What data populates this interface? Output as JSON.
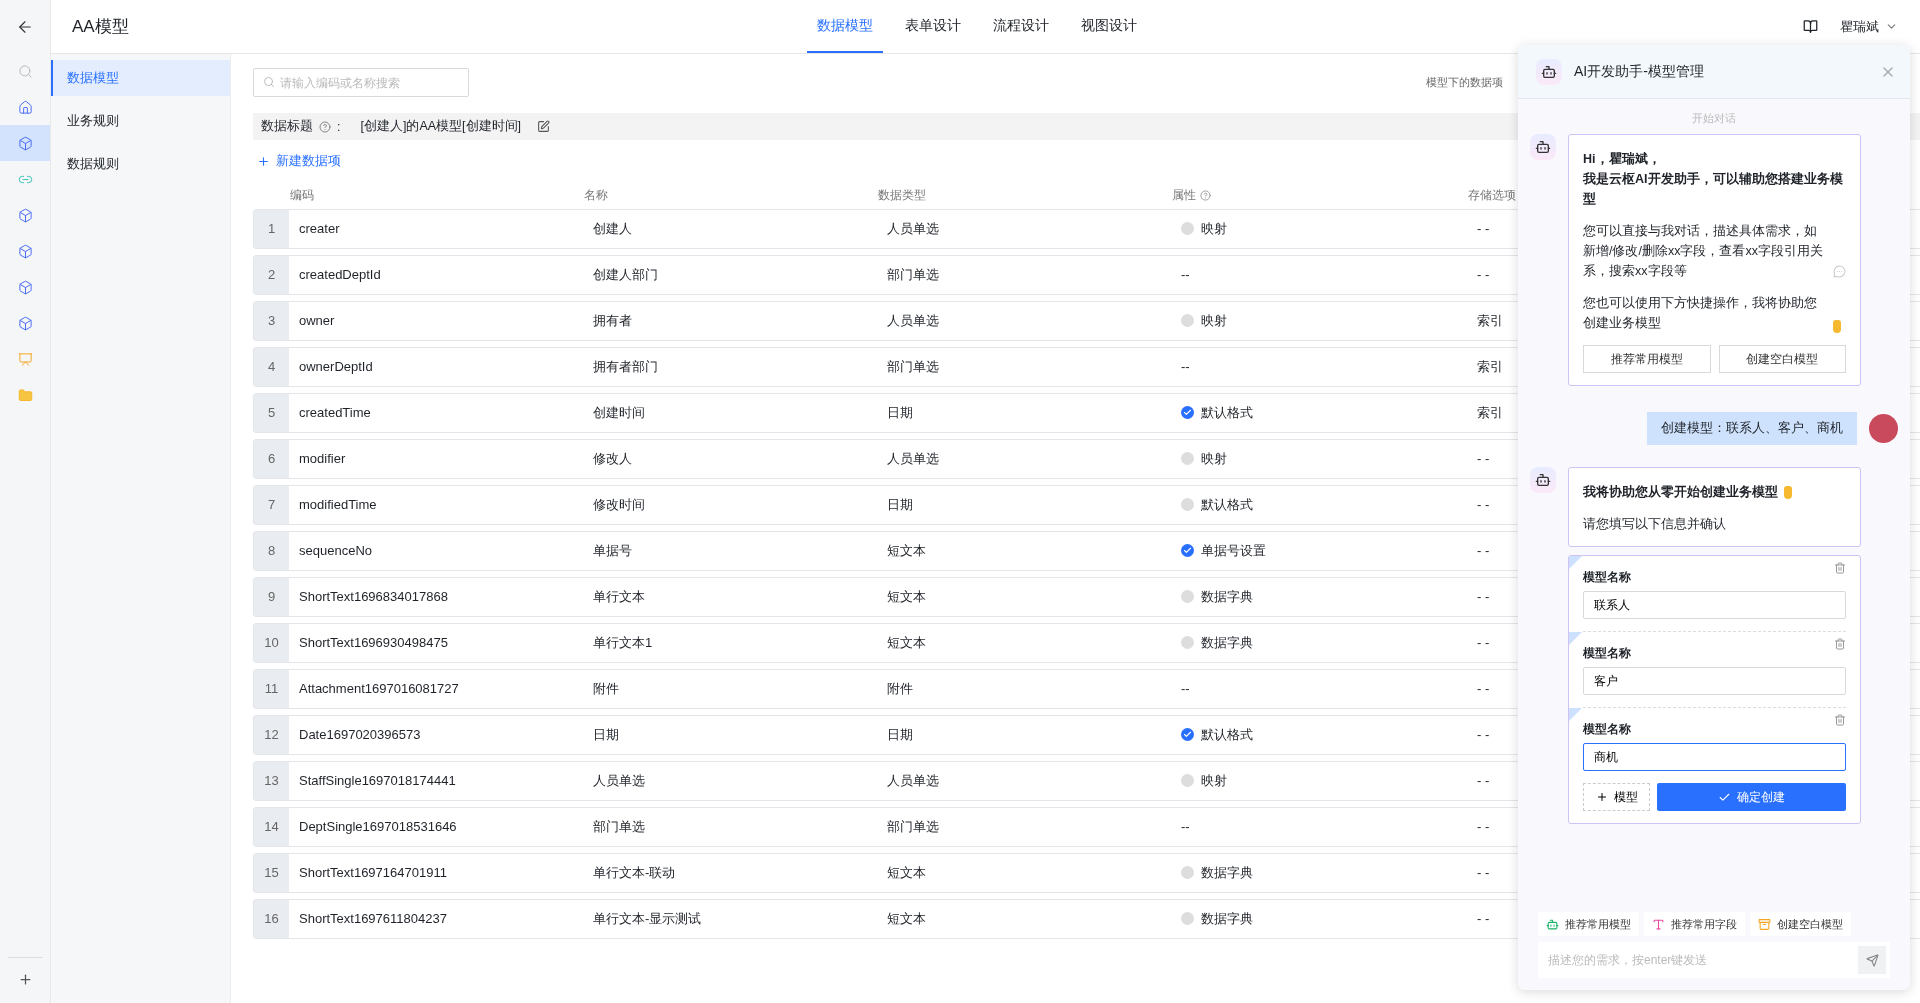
{
  "header": {
    "title": "AA模型",
    "tabs": [
      {
        "label": "数据模型",
        "selected": true
      },
      {
        "label": "表单设计",
        "selected": false
      },
      {
        "label": "流程设计",
        "selected": false
      },
      {
        "label": "视图设计",
        "selected": false
      }
    ],
    "user": "瞿瑞斌"
  },
  "rail": [
    {
      "kind": "search",
      "selected": false
    },
    {
      "kind": "home",
      "selected": false
    },
    {
      "kind": "cube",
      "selected": true
    },
    {
      "kind": "link",
      "selected": false
    },
    {
      "kind": "cube",
      "selected": false
    },
    {
      "kind": "cube",
      "selected": false
    },
    {
      "kind": "cube",
      "selected": false
    },
    {
      "kind": "cube",
      "selected": false
    },
    {
      "kind": "chart",
      "selected": false
    },
    {
      "kind": "folder",
      "selected": false
    }
  ],
  "sidebar": {
    "items": [
      {
        "label": "数据模型",
        "selected": true
      },
      {
        "label": "业务规则",
        "selected": false
      },
      {
        "label": "数据规则",
        "selected": false
      }
    ]
  },
  "toolbar": {
    "search_placeholder": "请输入编码或名称搜索",
    "note": "模型下的数据项"
  },
  "data_title": {
    "label": "数据标题",
    "separator": ":",
    "value": "[创建人]的AA模型[创建时间]"
  },
  "add_item": "新建数据项",
  "table": {
    "columns": [
      {
        "label": "编码",
        "help": false
      },
      {
        "label": "名称",
        "help": false
      },
      {
        "label": "数据类型",
        "help": false
      },
      {
        "label": "属性",
        "help": true
      },
      {
        "label": "存储选项",
        "help": false
      }
    ],
    "rows": [
      {
        "index": "1",
        "code": "creater",
        "name": "创建人",
        "type": "人员单选",
        "attribute": {
          "kind": "option",
          "label": "映射",
          "checked": false
        },
        "storage": "- -"
      },
      {
        "index": "2",
        "code": "createdDeptId",
        "name": "创建人部门",
        "type": "部门单选",
        "attribute": {
          "kind": "text",
          "label": "--"
        },
        "storage": "- -"
      },
      {
        "index": "3",
        "code": "owner",
        "name": "拥有者",
        "type": "人员单选",
        "attribute": {
          "kind": "option",
          "label": "映射",
          "checked": false
        },
        "storage": "索引"
      },
      {
        "index": "4",
        "code": "ownerDeptId",
        "name": "拥有者部门",
        "type": "部门单选",
        "attribute": {
          "kind": "text",
          "label": "--"
        },
        "storage": "索引"
      },
      {
        "index": "5",
        "code": "createdTime",
        "name": "创建时间",
        "type": "日期",
        "attribute": {
          "kind": "option",
          "label": "默认格式",
          "checked": true
        },
        "storage": "索引"
      },
      {
        "index": "6",
        "code": "modifier",
        "name": "修改人",
        "type": "人员单选",
        "attribute": {
          "kind": "option",
          "label": "映射",
          "checked": false
        },
        "storage": "- -"
      },
      {
        "index": "7",
        "code": "modifiedTime",
        "name": "修改时间",
        "type": "日期",
        "attribute": {
          "kind": "option",
          "label": "默认格式",
          "checked": false
        },
        "storage": "- -"
      },
      {
        "index": "8",
        "code": "sequenceNo",
        "name": "单据号",
        "type": "短文本",
        "attribute": {
          "kind": "option",
          "label": "单据号设置",
          "checked": true
        },
        "storage": "- -"
      },
      {
        "index": "9",
        "code": "ShortText1696834017868",
        "name": "单行文本",
        "type": "短文本",
        "attribute": {
          "kind": "option",
          "label": "数据字典",
          "checked": false
        },
        "storage": "- -"
      },
      {
        "index": "10",
        "code": "ShortText1696930498475",
        "name": "单行文本1",
        "type": "短文本",
        "attribute": {
          "kind": "option",
          "label": "数据字典",
          "checked": false
        },
        "storage": "- -"
      },
      {
        "index": "11",
        "code": "Attachment1697016081727",
        "name": "附件",
        "type": "附件",
        "attribute": {
          "kind": "text",
          "label": "--"
        },
        "storage": "- -"
      },
      {
        "index": "12",
        "code": "Date1697020396573",
        "name": "日期",
        "type": "日期",
        "attribute": {
          "kind": "option",
          "label": "默认格式",
          "checked": true
        },
        "storage": "- -"
      },
      {
        "index": "13",
        "code": "StaffSingle1697018174441",
        "name": "人员单选",
        "type": "人员单选",
        "attribute": {
          "kind": "option",
          "label": "映射",
          "checked": false
        },
        "storage": "- -"
      },
      {
        "index": "14",
        "code": "DeptSingle1697018531646",
        "name": "部门单选",
        "type": "部门单选",
        "attribute": {
          "kind": "text",
          "label": "--"
        },
        "storage": "- -"
      },
      {
        "index": "15",
        "code": "ShortText1697164701911",
        "name": "单行文本-联动",
        "type": "短文本",
        "attribute": {
          "kind": "option",
          "label": "数据字典",
          "checked": false
        },
        "storage": "- -"
      },
      {
        "index": "16",
        "code": "ShortText1697611804237",
        "name": "单行文本-显示测试",
        "type": "短文本",
        "attribute": {
          "kind": "option",
          "label": "数据字典",
          "checked": false
        },
        "storage": "- -"
      }
    ]
  },
  "assistant": {
    "title": "AI开发助手-模型管理",
    "divider_label": "开始对话",
    "messages": [
      {
        "kind": "bot-intro",
        "greeting": "Hi，瞿瑞斌，",
        "headline": "我是云枢AI开发助手，可以辅助您搭建业务模型",
        "paragraphs": [
          {
            "kind": "chat",
            "text": "您可以直接与我对话，描述具体需求，如新增/修改/删除xx字段，查看xx字段引用关系，搜索xx字段等"
          },
          {
            "kind": "hand",
            "text": "您也可以使用下方快捷操作，我将协助您创建业务模型"
          }
        ],
        "actions": [
          "推荐常用模型",
          "创建空白模型"
        ]
      },
      {
        "kind": "user",
        "text": "创建模型：联系人、客户、商机"
      },
      {
        "kind": "bot-form",
        "title": "我将协助您从零开始创建业务模型",
        "subtitle": "请您填写以下信息并确认",
        "entries": [
          {
            "label": "模型名称",
            "value": "联系人",
            "focused": false
          },
          {
            "label": "模型名称",
            "value": "客户",
            "focused": false
          },
          {
            "label": "模型名称",
            "value": "商机",
            "focused": true
          }
        ],
        "add_label": "模型",
        "confirm_label": "确定创建"
      }
    ],
    "quick_actions": [
      {
        "kind": "robot",
        "label": "推荐常用模型"
      },
      {
        "kind": "text",
        "label": "推荐常用字段"
      },
      {
        "kind": "box",
        "label": "创建空白模型"
      }
    ],
    "input": {
      "placeholder": "描述您的需求，按enter键发送"
    }
  }
}
